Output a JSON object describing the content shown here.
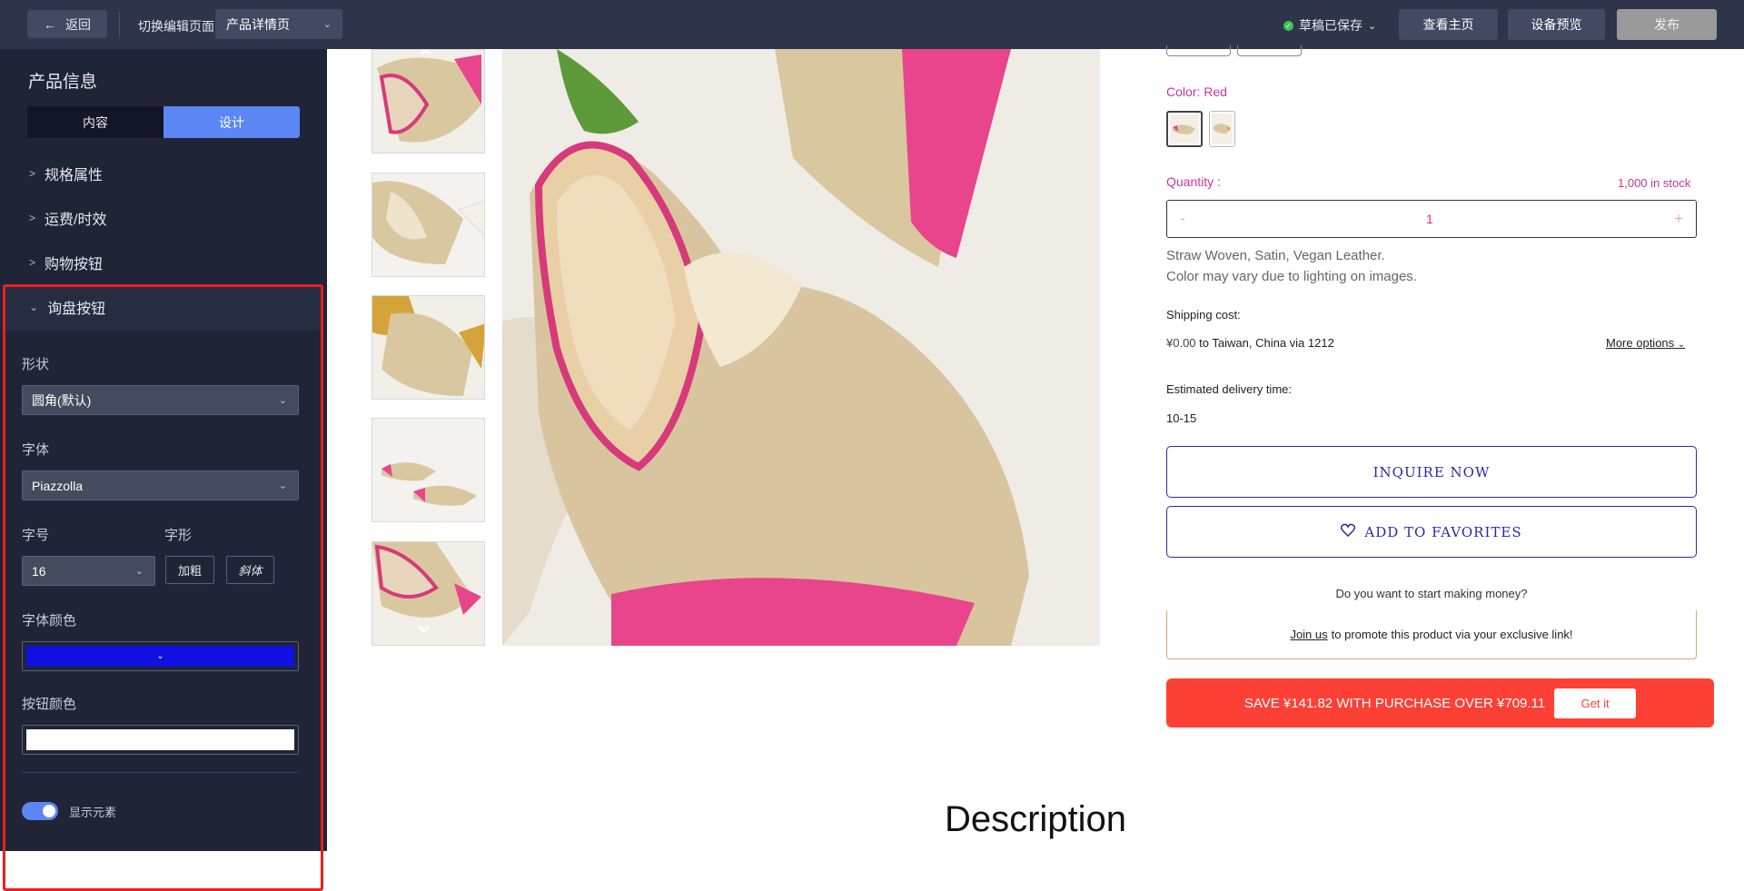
{
  "topbar": {
    "back_label": "返回",
    "switch_label": "切换编辑页面",
    "page_select_value": "产品详情页",
    "saved_status": "草稿已保存",
    "view_home": "查看主页",
    "device_preview": "设备预览",
    "publish": "发布"
  },
  "sidebar": {
    "title": "产品信息",
    "tabs": [
      {
        "label": "内容",
        "active": false
      },
      {
        "label": "设计",
        "active": true
      }
    ],
    "sections": [
      {
        "label": "规格属性",
        "expanded": false
      },
      {
        "label": "运费/时效",
        "expanded": false
      },
      {
        "label": "购物按钮",
        "expanded": false
      },
      {
        "label": "询盘按钮",
        "expanded": true
      }
    ],
    "inquiry": {
      "shape_label": "形状",
      "shape_value": "圆角(默认)",
      "font_label": "字体",
      "font_value": "Piazzolla",
      "size_label": "字号",
      "size_value": "16",
      "style_label": "字形",
      "bold_label": "加粗",
      "italic_label": "斜体",
      "font_color_label": "字体颜色",
      "font_color": "#1010e0",
      "button_color_label": "按钮颜色",
      "button_color": "#ffffff",
      "show_label": "显示元素",
      "show_enabled": true
    }
  },
  "product": {
    "color_text": "Color: Red",
    "quantity_label": "Quantity :",
    "stock_text": "1,000 in stock",
    "quantity_value": "1",
    "minus": "-",
    "plus": "+",
    "desc_line1": "Straw Woven, Satin, Vegan Leather.",
    "desc_line2": "Color may vary due to lighting on images.",
    "shipping_label": "Shipping cost:",
    "shipping_price": "¥0.00",
    "shipping_dest": "to Taiwan, China via 1212",
    "more_options": "More options",
    "delivery_label": "Estimated delivery time:",
    "delivery_value": "10-15",
    "inquire_btn": "INQUIRE NOW",
    "favorites_btn": "ADD TO FAVORITES",
    "earn_question": "Do you want to start making money?",
    "join_us": "Join us",
    "earn_text": "to promote this product via your exclusive link!",
    "save_text": "SAVE ¥141.82 WITH PURCHASE OVER ¥709.11",
    "get_it": "Get it",
    "description_title": "Description"
  },
  "colors": {
    "accent_blue": "#5b86f4",
    "highlight_red": "#e8211f",
    "product_magenta": "#c2379a",
    "inquire_blue": "#2a2aa8",
    "save_red": "#fd4035"
  }
}
